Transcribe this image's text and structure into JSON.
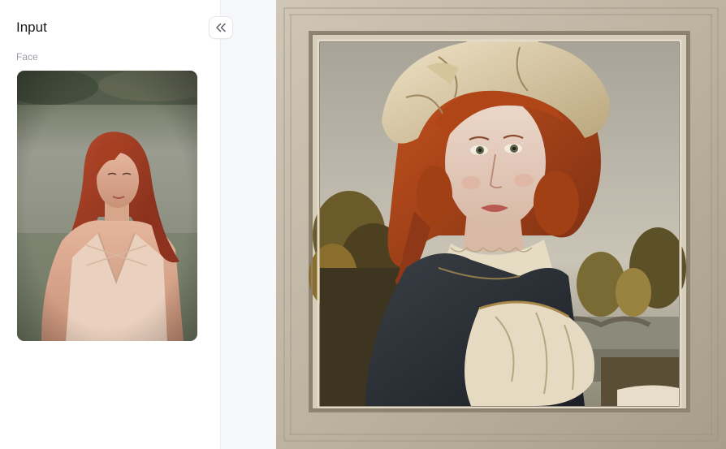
{
  "panel": {
    "title": "Input",
    "face_label": "Face",
    "collapse_icon": "double-chevron-left-icon"
  },
  "images": {
    "face_input": "woman-red-hair-field-photo",
    "result": "framed-oil-portrait"
  },
  "colors": {
    "panel_bg": "#ffffff",
    "canvas_bg": "#f7f8fa",
    "title_text": "#1a1a1a",
    "label_text": "#9aa0a8"
  }
}
